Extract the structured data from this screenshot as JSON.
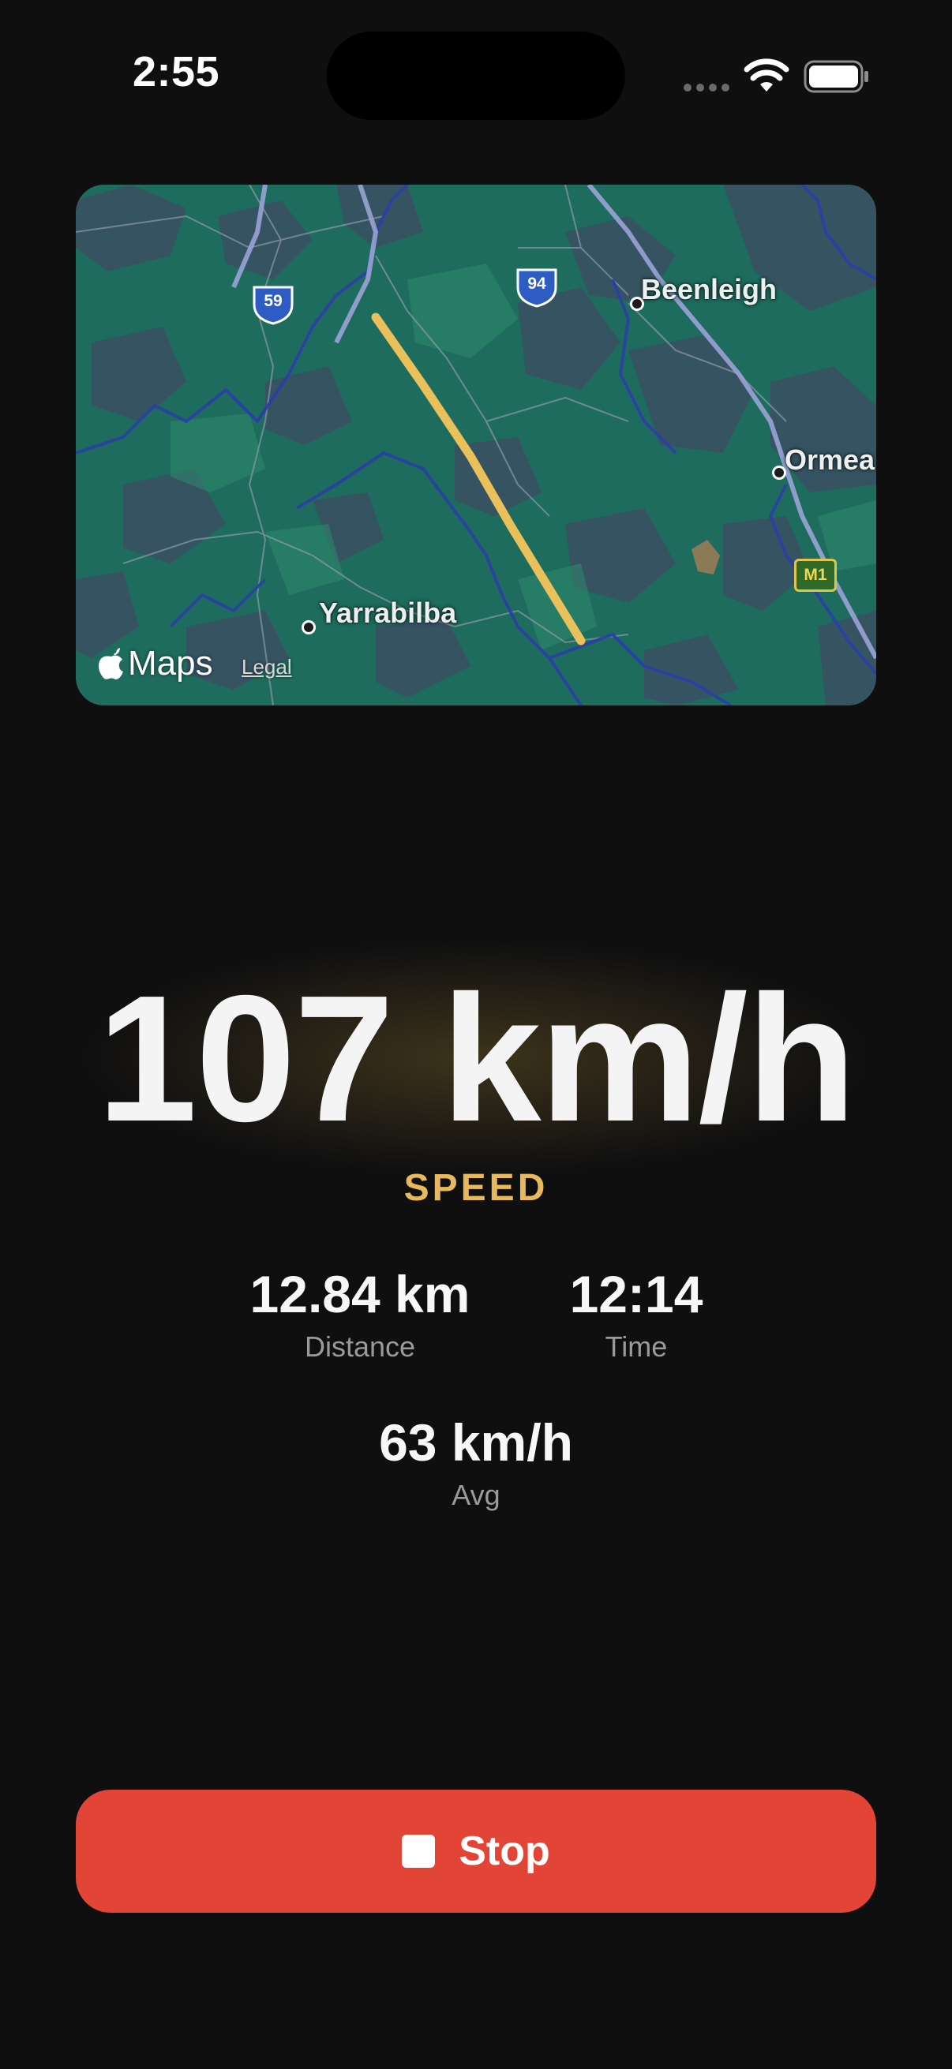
{
  "status_bar": {
    "time": "2:55",
    "icons": [
      "signal-dots-icon",
      "wifi-icon",
      "battery-icon"
    ]
  },
  "map": {
    "labels": {
      "beenleigh": "Beenleigh",
      "ormeau": "Ormea",
      "yarrabilba": "Yarrabilba"
    },
    "shields": {
      "route_59": "59",
      "route_94": "94",
      "route_m1": "M1"
    },
    "attribution": {
      "logo_text": "Maps",
      "legal": "Legal"
    },
    "route_color": "#e9c05a"
  },
  "speed": {
    "value": "107 km/h",
    "label": "SPEED"
  },
  "stats": {
    "distance": {
      "value": "12.84 km",
      "label": "Distance"
    },
    "time": {
      "value": "12:14",
      "label": "Time"
    },
    "avg": {
      "value": "63 km/h",
      "label": "Avg"
    }
  },
  "stop_button": {
    "label": "Stop",
    "color": "#e24436"
  },
  "colors": {
    "background": "#0f0f10",
    "accent": "#e8b95a"
  }
}
